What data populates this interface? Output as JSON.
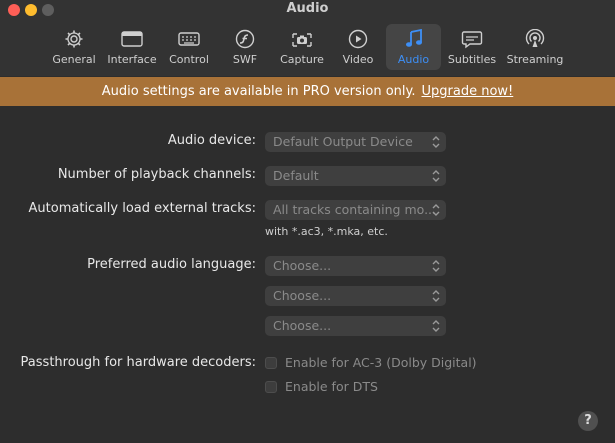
{
  "window": {
    "title": "Audio"
  },
  "toolbar": {
    "items": [
      {
        "label": "General",
        "icon": "gear-icon"
      },
      {
        "label": "Interface",
        "icon": "window-icon"
      },
      {
        "label": "Control",
        "icon": "keyboard-icon"
      },
      {
        "label": "SWF",
        "icon": "flash-icon"
      },
      {
        "label": "Capture",
        "icon": "camera-icon"
      },
      {
        "label": "Video",
        "icon": "play-icon"
      },
      {
        "label": "Audio",
        "icon": "music-note-icon",
        "active": true
      },
      {
        "label": "Subtitles",
        "icon": "speech-bubble-icon"
      },
      {
        "label": "Streaming",
        "icon": "broadcast-icon"
      }
    ],
    "active_color": "#3d8ff6"
  },
  "banner": {
    "message": "Audio settings are available in PRO version only.",
    "link": "Upgrade now!",
    "background": "#a87238"
  },
  "settings": {
    "audio_device": {
      "label": "Audio device:",
      "value": "Default Output Device"
    },
    "playback_channels": {
      "label": "Number of playback channels:",
      "value": "Default"
    },
    "external_tracks": {
      "label": "Automatically load external tracks:",
      "value": "All tracks containing mo...",
      "hint": "with *.ac3, *.mka, etc."
    },
    "preferred_language": {
      "label": "Preferred audio language:",
      "choices": [
        "Choose...",
        "Choose...",
        "Choose..."
      ]
    },
    "passthrough": {
      "label": "Passthrough for hardware decoders:",
      "options": [
        "Enable for AC-3 (Dolby Digital)",
        "Enable for DTS"
      ]
    }
  },
  "help": {
    "glyph": "?"
  }
}
